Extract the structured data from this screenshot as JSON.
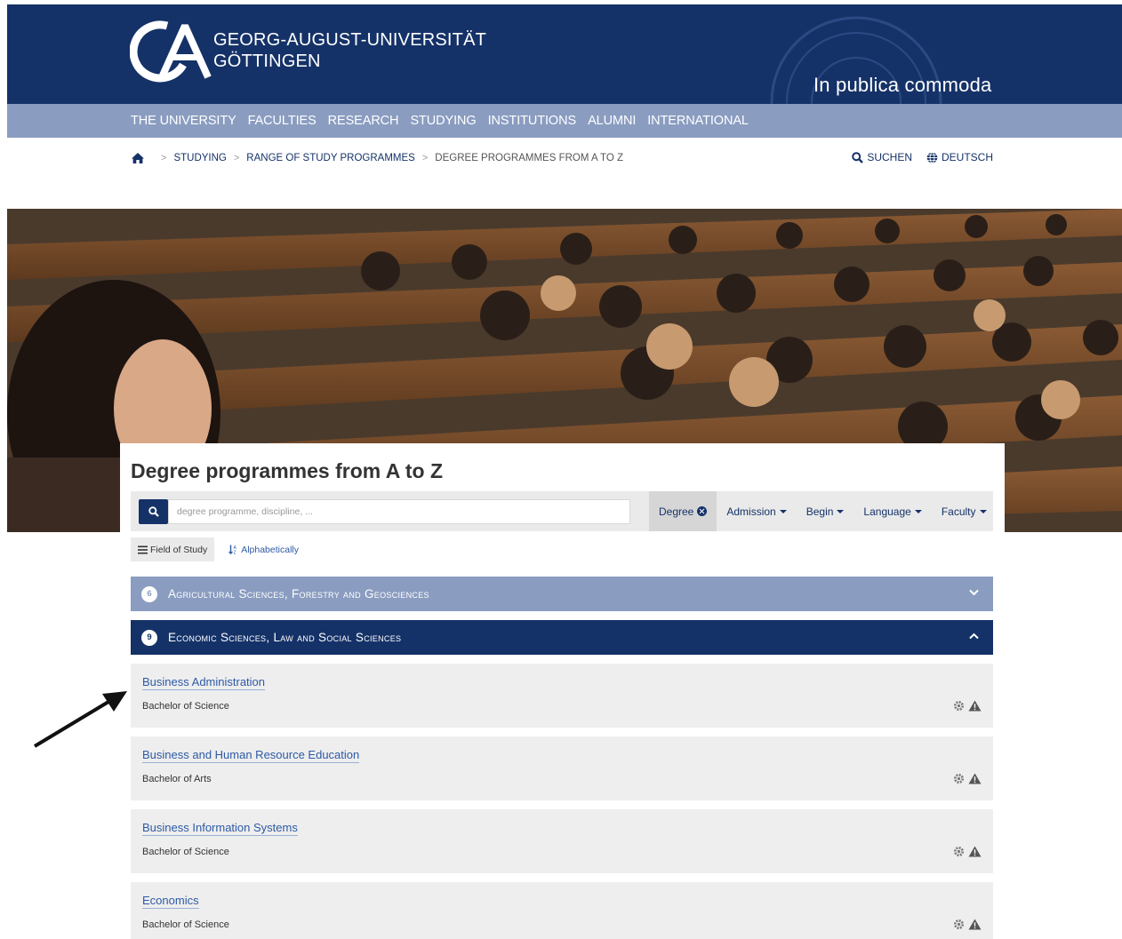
{
  "header": {
    "university_line1": "GEORG-AUGUST-UNIVERSITÄT",
    "university_line2": "GÖTTINGEN",
    "motto": "In publica commoda"
  },
  "nav": {
    "items": [
      "THE UNIVERSITY",
      "FACULTIES",
      "RESEARCH",
      "STUDYING",
      "INSTITUTIONS",
      "ALUMNI",
      "INTERNATIONAL"
    ]
  },
  "breadcrumb": {
    "items": [
      "STUDYING",
      "RANGE OF STUDY PROGRAMMES"
    ],
    "current": "DEGREE PROGRAMMES FROM A TO Z"
  },
  "tools": {
    "search": "SUCHEN",
    "language": "DEUTSCH"
  },
  "page": {
    "title": "Degree programmes from A to Z"
  },
  "search": {
    "placeholder": "degree programme, discipline, ..."
  },
  "filters": {
    "degree": "Degree",
    "admission": "Admission",
    "begin": "Begin",
    "language": "Language",
    "faculty": "Faculty"
  },
  "views": {
    "field_of_study": "Field of Study",
    "alphabetically": "Alphabetically"
  },
  "accordions": [
    {
      "count": "6",
      "title": "Agricultural Sciences, Forestry and Geosciences",
      "state": "collapsed"
    },
    {
      "count": "9",
      "title": "Economic Sciences, Law and Social Sciences",
      "state": "expanded"
    }
  ],
  "programmes": [
    {
      "name": "Business Administration",
      "degree": "Bachelor of Science"
    },
    {
      "name": "Business and Human Resource Education",
      "degree": "Bachelor of Arts"
    },
    {
      "name": "Business Information Systems",
      "degree": "Bachelor of Science"
    },
    {
      "name": "Economics",
      "degree": "Bachelor of Science"
    }
  ],
  "colors": {
    "primary_navy": "#153268",
    "nav_blue_grey": "#8a9cc0",
    "link_blue": "#2d5aa5",
    "card_grey": "#eeeeee"
  },
  "icons": [
    "home-icon",
    "search-icon",
    "globe-icon",
    "list-icon",
    "sort-icon",
    "gear-icon",
    "warning-icon",
    "chevron-down-icon",
    "chevron-up-icon"
  ]
}
